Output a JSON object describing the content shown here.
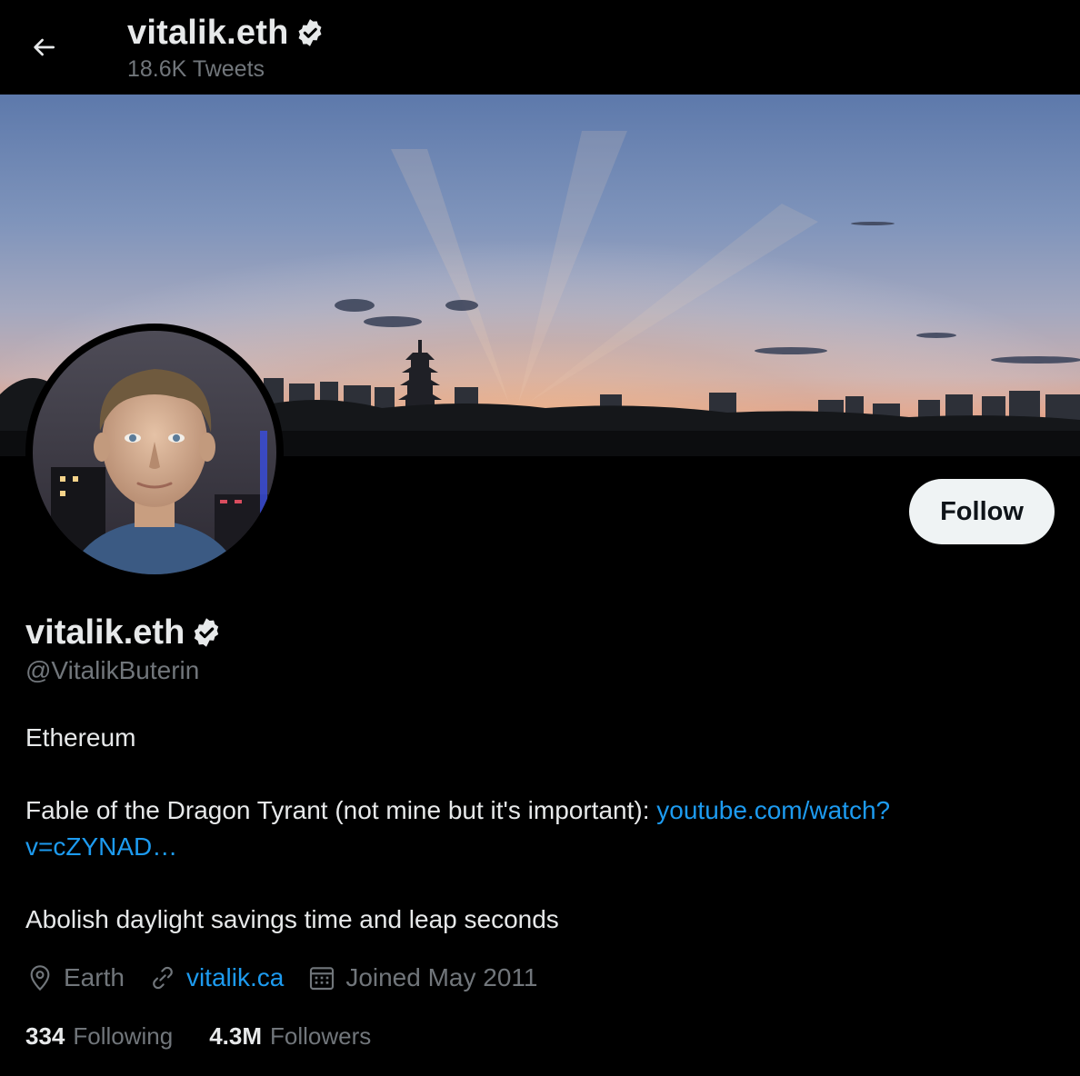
{
  "header": {
    "name": "vitalik.eth",
    "tweet_count": "18.6K Tweets"
  },
  "profile": {
    "name": "vitalik.eth",
    "handle": "@VitalikButerin",
    "follow_label": "Follow",
    "bio": {
      "line1": "Ethereum",
      "line2_text": "Fable of the Dragon Tyrant (not mine but it's important): ",
      "line2_link": "youtube.com/watch?",
      "line3_link": "v=cZYNAD…",
      "line4": "Abolish daylight savings time and leap seconds"
    },
    "location": "Earth",
    "website": "vitalik.ca",
    "joined": "Joined May 2011",
    "following_count": "334",
    "following_label": "Following",
    "followers_count": "4.3M",
    "followers_label": "Followers"
  },
  "icons": {
    "back": "arrow-left-icon",
    "verified": "verified-badge-icon",
    "location": "location-pin-icon",
    "link": "link-icon",
    "calendar": "calendar-icon"
  },
  "colors": {
    "background": "#000000",
    "text_primary": "#e7e9ea",
    "text_secondary": "#71767b",
    "link": "#1d9bf0",
    "follow_bg": "#eff3f4",
    "follow_text": "#0f1419"
  }
}
